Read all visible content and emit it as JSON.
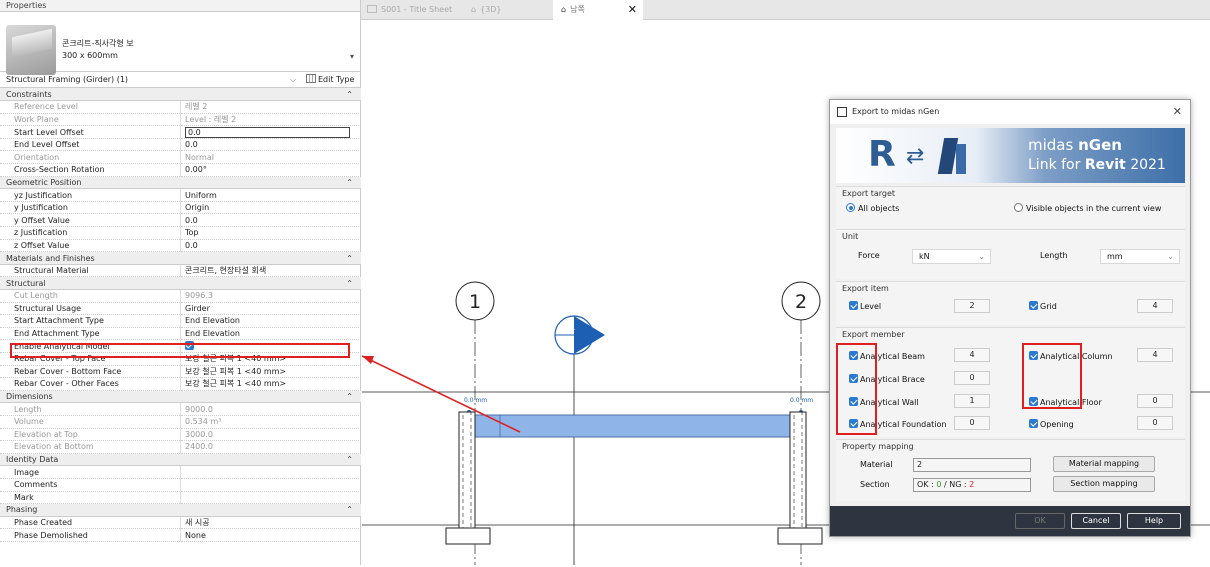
{
  "properties": {
    "title": "Properties",
    "type_name_line1": "콘크리트-직사각형 보",
    "type_name_line2": "300 x 600mm",
    "filter": "Structural Framing (Girder) (1)",
    "edit_type": "Edit Type",
    "rows": [
      {
        "kind": "sec",
        "name": "Constraints"
      },
      {
        "kind": "grey",
        "name": "Reference Level",
        "value": "레벨 2"
      },
      {
        "kind": "grey",
        "name": "Work Plane",
        "value": "Level : 레벨 2"
      },
      {
        "kind": "input",
        "name": "Start Level Offset",
        "value": "0.0"
      },
      {
        "kind": "row",
        "name": "End Level Offset",
        "value": "0.0"
      },
      {
        "kind": "grey",
        "name": "Orientation",
        "value": "Normal"
      },
      {
        "kind": "row",
        "name": "Cross-Section Rotation",
        "value": "0.00°"
      },
      {
        "kind": "sec",
        "name": "Geometric Position"
      },
      {
        "kind": "row",
        "name": "yz Justification",
        "value": "Uniform"
      },
      {
        "kind": "row",
        "name": "y Justification",
        "value": "Origin"
      },
      {
        "kind": "row",
        "name": "y Offset Value",
        "value": "0.0"
      },
      {
        "kind": "row",
        "name": "z Justification",
        "value": "Top"
      },
      {
        "kind": "row",
        "name": "z Offset Value",
        "value": "0.0"
      },
      {
        "kind": "sec",
        "name": "Materials and Finishes"
      },
      {
        "kind": "row",
        "name": "Structural Material",
        "value": "콘크리트, 현장타설 회색"
      },
      {
        "kind": "sec",
        "name": "Structural"
      },
      {
        "kind": "grey",
        "name": "Cut Length",
        "value": "9096.3"
      },
      {
        "kind": "row",
        "name": "Structural Usage",
        "value": "Girder"
      },
      {
        "kind": "row",
        "name": "Start Attachment Type",
        "value": "End Elevation"
      },
      {
        "kind": "row",
        "name": "End Attachment Type",
        "value": "End Elevation"
      },
      {
        "kind": "check",
        "name": "Enable Analytical Model",
        "value": ""
      },
      {
        "kind": "row",
        "name": "Rebar Cover - Top Face",
        "value": "보강 철근 피복 1 <40 mm>"
      },
      {
        "kind": "row",
        "name": "Rebar Cover - Bottom Face",
        "value": "보강 철근 피복 1 <40 mm>"
      },
      {
        "kind": "row",
        "name": "Rebar Cover - Other Faces",
        "value": "보강 철근 피복 1 <40 mm>"
      },
      {
        "kind": "sec",
        "name": "Dimensions"
      },
      {
        "kind": "grey",
        "name": "Length",
        "value": "9000.0"
      },
      {
        "kind": "grey",
        "name": "Volume",
        "value": "0.534 m³"
      },
      {
        "kind": "grey",
        "name": "Elevation at Top",
        "value": "3000.0"
      },
      {
        "kind": "grey",
        "name": "Elevation at Bottom",
        "value": "2400.0"
      },
      {
        "kind": "sec",
        "name": "Identity Data"
      },
      {
        "kind": "row",
        "name": "Image",
        "value": ""
      },
      {
        "kind": "row",
        "name": "Comments",
        "value": ""
      },
      {
        "kind": "row",
        "name": "Mark",
        "value": ""
      },
      {
        "kind": "sec",
        "name": "Phasing"
      },
      {
        "kind": "row",
        "name": "Phase Created",
        "value": "새 시공"
      },
      {
        "kind": "row",
        "name": "Phase Demolished",
        "value": "None"
      }
    ]
  },
  "tabs": [
    {
      "label": "S001 - Title Sheet"
    },
    {
      "label": "{3D}"
    },
    {
      "label": "남쪽"
    }
  ],
  "view": {
    "grid1": "1",
    "grid2": "2",
    "dim1": "0.0 mm",
    "dim2": "0.0 mm"
  },
  "dialog": {
    "title": "Export to midas nGen",
    "banner_brand": "midas",
    "banner_product": "nGen",
    "banner_line2_a": "Link for",
    "banner_line2_b": "Revit",
    "banner_line2_c": "2021",
    "export_target": {
      "label": "Export target",
      "opt_all": "All objects",
      "opt_visible": "Visible objects in the current view"
    },
    "unit": {
      "label": "Unit",
      "force_label": "Force",
      "force_value": "kN",
      "length_label": "Length",
      "length_value": "mm"
    },
    "export_item": {
      "label": "Export item",
      "level": "Level",
      "level_count": "2",
      "grid": "Grid",
      "grid_count": "4"
    },
    "export_member": {
      "label": "Export member",
      "beam": "Analytical Beam",
      "beam_count": "4",
      "column": "Analytical Column",
      "column_count": "4",
      "brace": "Analytical Brace",
      "brace_count": "0",
      "wall": "Analytical Wall",
      "wall_count": "1",
      "floor": "Analytical Floor",
      "floor_count": "0",
      "foundation": "Analytical Foundation",
      "foundation_count": "0",
      "opening": "Opening",
      "opening_count": "0"
    },
    "property_mapping": {
      "label": "Property mapping",
      "material_label": "Material",
      "material_value": "2",
      "section_label": "Section",
      "section_ok_prefix": "OK : ",
      "section_ok": "0",
      "section_sep": " / NG : ",
      "section_ng": "2",
      "material_btn": "Material mapping",
      "section_btn": "Section mapping"
    },
    "buttons": {
      "ok": "OK",
      "cancel": "Cancel",
      "help": "Help"
    }
  },
  "colors": {
    "accent": "#2b79d0",
    "highlight": "#e02020",
    "beam": "#8fb4e8"
  }
}
